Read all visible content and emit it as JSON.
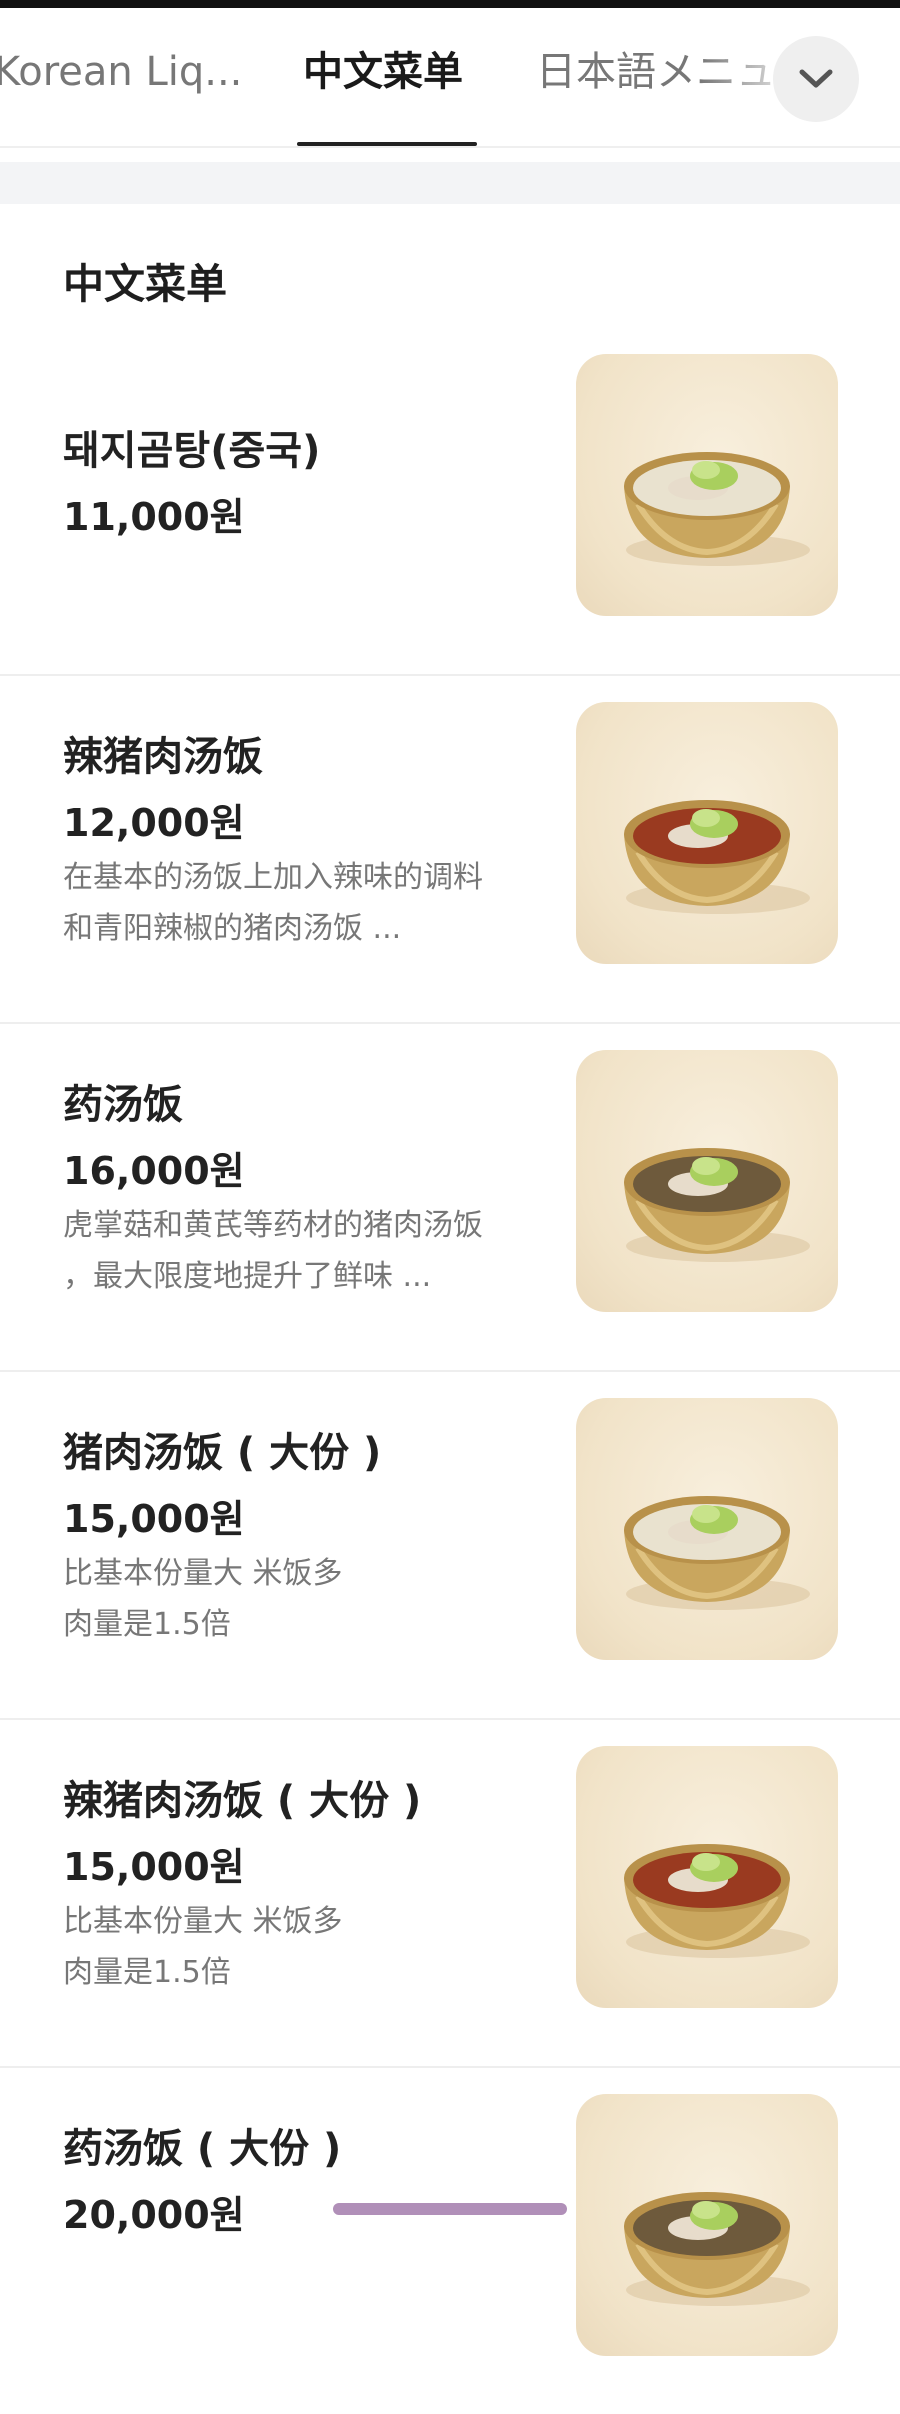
{
  "tabs": [
    {
      "label": "Korean Liq...",
      "active": false
    },
    {
      "label": "中文菜单",
      "active": true
    },
    {
      "label": "日本語メニュ",
      "active": false
    }
  ],
  "section": {
    "title": "中文菜单"
  },
  "items": [
    {
      "name": "돼지곰탕(중국)",
      "price": "11,000원",
      "desc": [],
      "soup": "clear"
    },
    {
      "name": "辣猪肉汤饭",
      "price": "12,000원",
      "desc": [
        "在基本的汤饭上加入辣味的调料",
        "和青阳辣椒的猪肉汤饭 ..."
      ],
      "soup": "spicy"
    },
    {
      "name": "药汤饭",
      "price": "16,000원",
      "desc": [
        "虎掌菇和黄芪等药材的猪肉汤饭",
        "，最大限度地提升了鲜味 ..."
      ],
      "soup": "herbal"
    },
    {
      "name": "猪肉汤饭 ( 大份 )",
      "price": "15,000원",
      "desc": [
        "比基本份量大 米饭多",
        "肉量是1.5倍"
      ],
      "soup": "clear"
    },
    {
      "name": "辣猪肉汤饭 ( 大份 )",
      "price": "15,000원",
      "desc": [
        "比基本份量大 米饭多",
        "肉量是1.5倍"
      ],
      "soup": "spicy"
    },
    {
      "name": "药汤饭 ( 大份 )",
      "price": "20,000원",
      "desc": [],
      "soup": "herbal"
    }
  ],
  "icons": {
    "dropdown": "chevron-down-icon",
    "food_photo": "bowl-soup-photo"
  },
  "colors": {
    "soup_clear": "#e9e2cf",
    "soup_spicy": "#9a3a20",
    "soup_herbal": "#6e5a3c"
  }
}
